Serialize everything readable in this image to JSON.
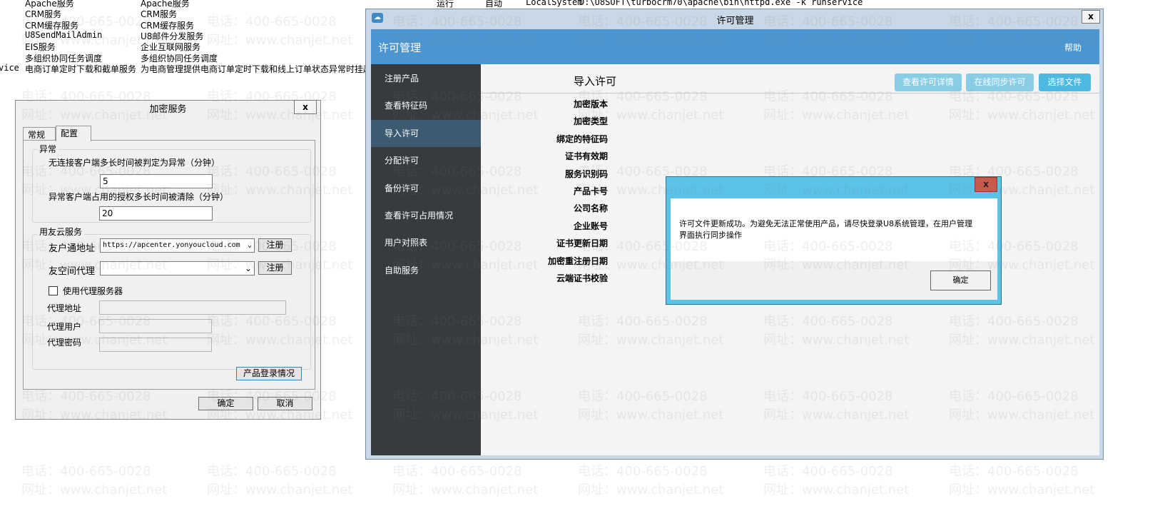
{
  "background_services": {
    "top_row": {
      "status": "运行",
      "startup": "自动",
      "account": "LocalSystem",
      "path": "D:\\U8SOFT\\turbocrm70\\apache\\bin\\httpd.exe  -k runservice"
    },
    "rows": [
      {
        "name": "Apache服务",
        "desc": "Apache服务"
      },
      {
        "name": "CRM服务",
        "desc": "CRM服务"
      },
      {
        "name": "CRM缓存服务",
        "desc": "CRM缓存服务"
      },
      {
        "name": "U8SendMailAdmin",
        "desc": "U8邮件分发服务"
      },
      {
        "name": "EIS服务",
        "desc": "企业互联网服务"
      },
      {
        "name": "多组织协同任务调度",
        "desc": "多组织协同任务调度"
      },
      {
        "prefix": "vice",
        "name": "电商订单定时下载和截单服务",
        "desc": "为电商管理提供电商订单定时下载和线上订单状态异常时挂起订"
      }
    ]
  },
  "watermark": {
    "phone": "电话：400-665-0028",
    "site": "网址：www.chanjet.net"
  },
  "encrypt_dialog": {
    "title": "加密服务",
    "close": "x",
    "tabs": [
      {
        "label": "常规",
        "active": false
      },
      {
        "label": "配置",
        "active": true
      }
    ],
    "group_abnormal": {
      "title": "异常",
      "label1": "无连接客户端多长时间被判定为异常（分钟）",
      "value1": "5",
      "label2": "异常客户端占用的授权多长时间被清除（分钟）",
      "value2": "20"
    },
    "group_cloud": {
      "title": "用友云服务",
      "yht_label": "友户通地址",
      "yht_value": "https://apcenter.yonyoucloud.com",
      "register": "注册",
      "proxy_label": "友空间代理",
      "proxy_value": "",
      "use_proxy_label": "使用代理服务器",
      "use_proxy_checked": false,
      "addr_label": "代理地址",
      "user_label": "代理用户",
      "pwd_label": "代理密码"
    },
    "login_btn": "产品登录情况",
    "ok": "确定",
    "cancel": "取消"
  },
  "license_window": {
    "title": "许可管理",
    "close": "x",
    "header_title": "许可管理",
    "help": "帮助",
    "sidebar": [
      {
        "label": "注册产品"
      },
      {
        "label": "查看特征码"
      },
      {
        "label": "导入许可",
        "selected": true
      },
      {
        "label": "分配许可"
      },
      {
        "label": "备份许可"
      },
      {
        "label": "查看许可占用情况"
      },
      {
        "label": "用户对照表"
      },
      {
        "label": "自助服务"
      }
    ],
    "page_title": "导入许可",
    "buttons": [
      "查看许可详情",
      "在线同步许可",
      "选择文件"
    ],
    "fields": [
      "加密版本",
      "加密类型",
      "绑定的特征码",
      "证书有效期",
      "服务识别码",
      "产品卡号",
      "公司名称",
      "企业账号",
      "证书更新日期",
      "加密重注册日期",
      "云端证书校验"
    ],
    "colors": {
      "header": "#4b96d1",
      "sidebar": "#353b3e",
      "sidebar_selected": "#3d5b70",
      "button_light": "#87cde6",
      "button": "#4cb9e2"
    }
  },
  "message_dialog": {
    "close": "x",
    "text": "许可文件更新成功。为避免无法正常使用产品，请尽快登录U8系统管理，在用户管理界面执行同步操作",
    "ok": "确定"
  }
}
